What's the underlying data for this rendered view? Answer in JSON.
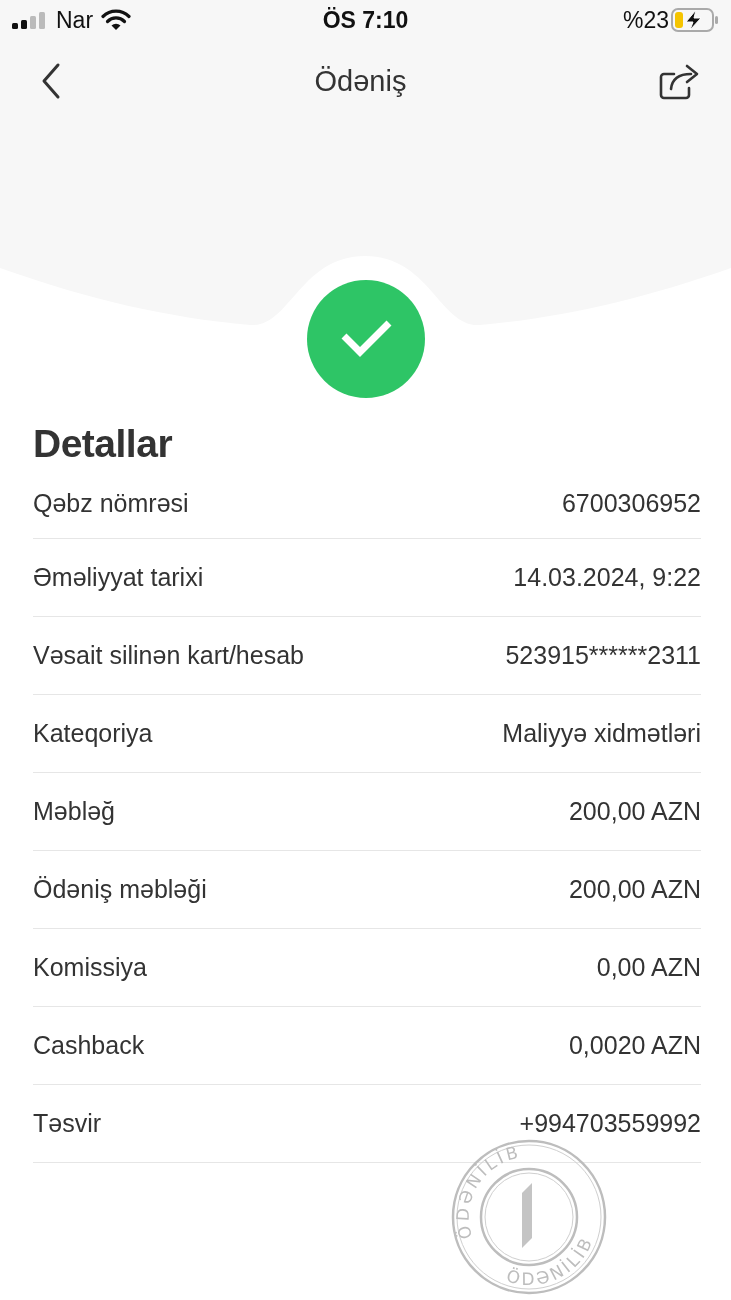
{
  "status_bar": {
    "carrier": "Nar",
    "time": "ÖS 7:10",
    "battery": "%23"
  },
  "header": {
    "title": "Ödəniş"
  },
  "details": {
    "title": "Detallar",
    "rows": [
      {
        "label": "Qəbz nömrəsi",
        "value": "6700306952"
      },
      {
        "label": "Əməliyyat tarixi",
        "value": "14.03.2024, 9:22"
      },
      {
        "label": "Vəsait silinən kart/hesab",
        "value": "523915******2311"
      },
      {
        "label": "Kateqoriya",
        "value": "Maliyyə xidmətləri"
      },
      {
        "label": "Məbləğ",
        "value": "200,00 AZN"
      },
      {
        "label": "Ödəniş məbləği",
        "value": "200,00 AZN"
      },
      {
        "label": "Komissiya",
        "value": "0,00 AZN"
      },
      {
        "label": "Cashback",
        "value": "0,0020 AZN"
      },
      {
        "label": "Təsvir",
        "value": "+994703559992"
      }
    ]
  },
  "stamp": {
    "texts": [
      "ÖDƏNİLİB",
      "ÖDƏNİLİB"
    ]
  }
}
